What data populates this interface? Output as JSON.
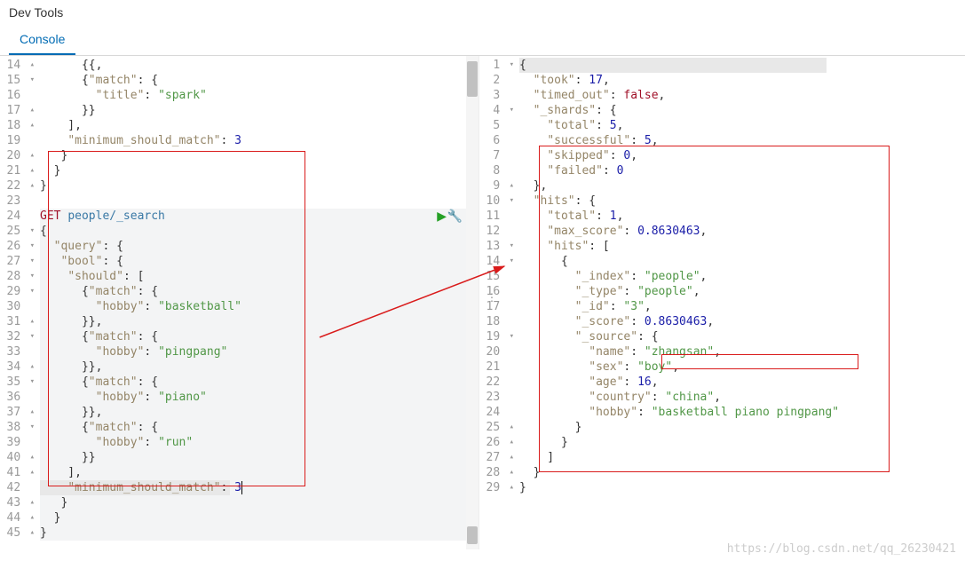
{
  "header": {
    "title": "Dev Tools"
  },
  "tabs": {
    "console": "Console"
  },
  "left_editor": {
    "lines": [
      {
        "num": 14,
        "fold": "▴",
        "html": "      {{,"
      },
      {
        "num": 15,
        "fold": "▾",
        "html": "      {<span class='key'>\"match\"</span>: {"
      },
      {
        "num": 16,
        "fold": "",
        "html": "        <span class='key'>\"title\"</span>: <span class='str'>\"spark\"</span>"
      },
      {
        "num": 17,
        "fold": "▴",
        "html": "      }}"
      },
      {
        "num": 18,
        "fold": "▴",
        "html": "    ],"
      },
      {
        "num": 19,
        "fold": "",
        "html": "    <span class='key'>\"minimum_should_match\"</span>: <span class='num'>3</span>"
      },
      {
        "num": 20,
        "fold": "▴",
        "html": "   }"
      },
      {
        "num": 21,
        "fold": "▴",
        "html": "  }"
      },
      {
        "num": 22,
        "fold": "▴",
        "html": "}"
      },
      {
        "num": 23,
        "fold": "",
        "html": ""
      },
      {
        "num": 24,
        "fold": "",
        "html": "<span class='kw'>GET</span> <span class='path'>people/_search</span>"
      },
      {
        "num": 25,
        "fold": "▾",
        "html": "{"
      },
      {
        "num": 26,
        "fold": "▾",
        "html": "  <span class='key'>\"query\"</span>: {"
      },
      {
        "num": 27,
        "fold": "▾",
        "html": "   <span class='key'>\"bool\"</span>: {"
      },
      {
        "num": 28,
        "fold": "▾",
        "html": "    <span class='key'>\"should\"</span>: ["
      },
      {
        "num": 29,
        "fold": "▾",
        "html": "      {<span class='key'>\"match\"</span>: {"
      },
      {
        "num": 30,
        "fold": "",
        "html": "        <span class='key'>\"hobby\"</span>: <span class='str'>\"basketball\"</span>"
      },
      {
        "num": 31,
        "fold": "▴",
        "html": "      }},"
      },
      {
        "num": 32,
        "fold": "▾",
        "html": "      {<span class='key'>\"match\"</span>: {"
      },
      {
        "num": 33,
        "fold": "",
        "html": "        <span class='key'>\"hobby\"</span>: <span class='str'>\"pingpang\"</span>"
      },
      {
        "num": 34,
        "fold": "▴",
        "html": "      }},"
      },
      {
        "num": 35,
        "fold": "▾",
        "html": "      {<span class='key'>\"match\"</span>: {"
      },
      {
        "num": 36,
        "fold": "",
        "html": "        <span class='key'>\"hobby\"</span>: <span class='str'>\"piano\"</span>"
      },
      {
        "num": 37,
        "fold": "▴",
        "html": "      }},"
      },
      {
        "num": 38,
        "fold": "▾",
        "html": "      {<span class='key'>\"match\"</span>: {"
      },
      {
        "num": 39,
        "fold": "",
        "html": "        <span class='key'>\"hobby\"</span>: <span class='str'>\"run\"</span>"
      },
      {
        "num": 40,
        "fold": "▴",
        "html": "      }}"
      },
      {
        "num": 41,
        "fold": "▴",
        "html": "    ],"
      },
      {
        "num": 42,
        "fold": "",
        "html": "    <span class='key'>\"minimum_should_match\"</span>: <span class='num'>3</span><span class='cursor'></span>",
        "hl": true
      },
      {
        "num": 43,
        "fold": "▴",
        "html": "   }"
      },
      {
        "num": 44,
        "fold": "▴",
        "html": "  }"
      },
      {
        "num": 45,
        "fold": "▴",
        "html": "}"
      }
    ]
  },
  "right_editor": {
    "lines": [
      {
        "num": 1,
        "fold": "▾",
        "html": "{",
        "hl": true
      },
      {
        "num": 2,
        "fold": "",
        "html": "  <span class='key'>\"took\"</span>: <span class='num'>17</span>,"
      },
      {
        "num": 3,
        "fold": "",
        "html": "  <span class='key'>\"timed_out\"</span>: <span class='bool'>false</span>,"
      },
      {
        "num": 4,
        "fold": "▾",
        "html": "  <span class='key'>\"_shards\"</span>: {"
      },
      {
        "num": 5,
        "fold": "",
        "html": "    <span class='key'>\"total\"</span>: <span class='num'>5</span>,"
      },
      {
        "num": 6,
        "fold": "",
        "html": "    <span class='key'>\"successful\"</span>: <span class='num'>5</span>,"
      },
      {
        "num": 7,
        "fold": "",
        "html": "    <span class='key'>\"skipped\"</span>: <span class='num'>0</span>,"
      },
      {
        "num": 8,
        "fold": "",
        "html": "    <span class='key'>\"failed\"</span>: <span class='num'>0</span>"
      },
      {
        "num": 9,
        "fold": "▴",
        "html": "  },"
      },
      {
        "num": 10,
        "fold": "▾",
        "html": "  <span class='key'>\"hits\"</span>: {"
      },
      {
        "num": 11,
        "fold": "",
        "html": "    <span class='key'>\"total\"</span>: <span class='num'>1</span>,"
      },
      {
        "num": 12,
        "fold": "",
        "html": "    <span class='key'>\"max_score\"</span>: <span class='num'>0.8630463</span>,"
      },
      {
        "num": 13,
        "fold": "▾",
        "html": "    <span class='key'>\"hits\"</span>: ["
      },
      {
        "num": 14,
        "fold": "▾",
        "html": "      {"
      },
      {
        "num": 15,
        "fold": "",
        "html": "        <span class='key'>\"_index\"</span>: <span class='str'>\"people\"</span>,"
      },
      {
        "num": 16,
        "fold": "",
        "html": "        <span class='key'>\"_type\"</span>: <span class='str'>\"people\"</span>,"
      },
      {
        "num": 17,
        "fold": "",
        "html": "        <span class='key'>\"_id\"</span>: <span class='str'>\"3\"</span>,"
      },
      {
        "num": 18,
        "fold": "",
        "html": "        <span class='key'>\"_score\"</span>: <span class='num'>0.8630463</span>,"
      },
      {
        "num": 19,
        "fold": "▾",
        "html": "        <span class='key'>\"_source\"</span>: {"
      },
      {
        "num": 20,
        "fold": "",
        "html": "          <span class='key'>\"name\"</span>: <span class='str'>\"zhangsan\"</span>,"
      },
      {
        "num": 21,
        "fold": "",
        "html": "          <span class='key'>\"sex\"</span>: <span class='str'>\"boy\"</span>,"
      },
      {
        "num": 22,
        "fold": "",
        "html": "          <span class='key'>\"age\"</span>: <span class='num'>16</span>,"
      },
      {
        "num": 23,
        "fold": "",
        "html": "          <span class='key'>\"country\"</span>: <span class='str'>\"china\"</span>,"
      },
      {
        "num": 24,
        "fold": "",
        "html": "          <span class='key'>\"hobby\"</span>: <span class='str'>\"basketball piano pingpang\"</span>"
      },
      {
        "num": 25,
        "fold": "▴",
        "html": "        }"
      },
      {
        "num": 26,
        "fold": "▴",
        "html": "      }"
      },
      {
        "num": 27,
        "fold": "▴",
        "html": "    ]"
      },
      {
        "num": 28,
        "fold": "▴",
        "html": "  }"
      },
      {
        "num": 29,
        "fold": "▴",
        "html": "}"
      }
    ]
  },
  "icons": {
    "play": "▶",
    "wrench": "🔧"
  },
  "watermark": "https://blog.csdn.net/qq_26230421"
}
